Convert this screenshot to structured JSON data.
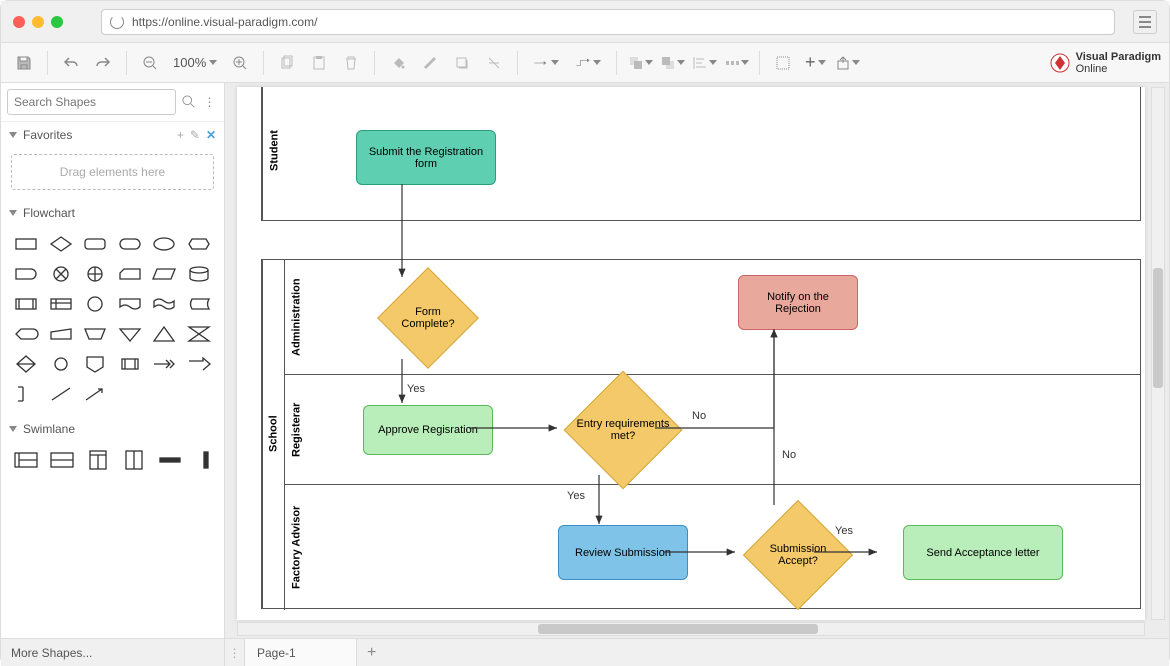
{
  "browser": {
    "url": "https://online.visual-paradigm.com/"
  },
  "brand": {
    "line1": "Visual Paradigm",
    "line2": "Online"
  },
  "toolbar": {
    "zoom": "100%"
  },
  "sidebar": {
    "search_placeholder": "Search Shapes",
    "favorites_label": "Favorites",
    "drag_hint": "Drag elements here",
    "flowchart_label": "Flowchart",
    "swimlane_label": "Swimlane",
    "more_shapes": "More Shapes..."
  },
  "footer": {
    "page_tab": "Page-1"
  },
  "diagram": {
    "lanes": {
      "student": "Student",
      "school": "School",
      "administration": "Administration",
      "registerar": "Registerar",
      "factory_advisor": "Factory Advisor"
    },
    "nodes": {
      "submit": "Submit the Registration form",
      "form_complete": "Form Complete?",
      "approve": "Approve Regisration",
      "entry_req": "Entry requirements met?",
      "notify_reject": "Notify on the Rejection",
      "review": "Review Submission",
      "submission_accept": "Submission Accept?",
      "send_accept": "Send Acceptance letter"
    },
    "edges": {
      "yes1": "Yes",
      "no1": "No",
      "yes2": "Yes",
      "no2": "No",
      "yes3": "Yes"
    }
  }
}
